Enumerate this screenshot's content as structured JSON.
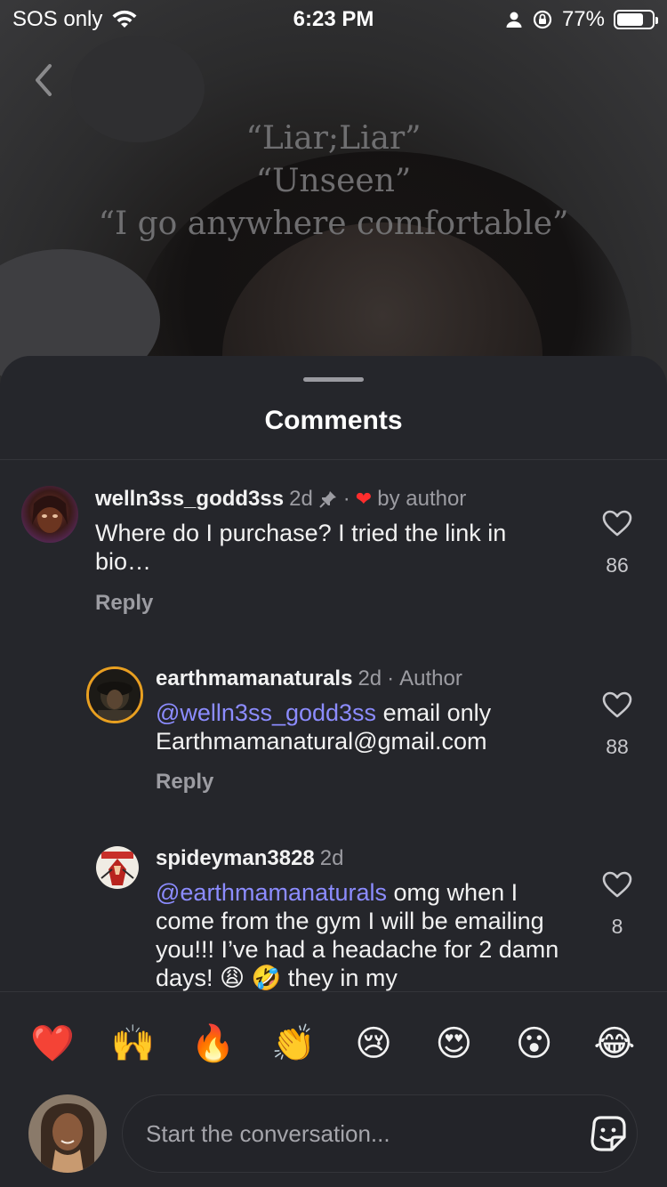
{
  "status_bar": {
    "carrier": "SOS only",
    "time": "6:23 PM",
    "battery": "77%",
    "battery_level": 0.77
  },
  "video_overlay": {
    "lines": [
      "“Liar;Liar”",
      "“Unseen”",
      "“I go anywhere comfortable”"
    ]
  },
  "sheet": {
    "title": "Comments"
  },
  "comments": [
    {
      "username": "welln3ss_godd3ss",
      "age": "2d",
      "meta_suffix": "by author",
      "text": "Where do I purchase? I tried the link in bio…",
      "reply_label": "Reply",
      "likes": "86",
      "pinned": true,
      "liked_by_author": true
    },
    {
      "username": "earthmamanaturals",
      "age": "2d",
      "meta_suffix": "Author",
      "mention": "@welln3ss_godd3ss",
      "text": " email only Earthmamanatural@gmail.com",
      "reply_label": "Reply",
      "likes": "88"
    },
    {
      "username": "spideyman3828",
      "age": "2d",
      "mention": "@earthmamanaturals",
      "text": " omg when I come from the gym I will be emailing you!!! I’ve had a headache for 2 damn days! 😩 🤣 they in my",
      "likes": "8"
    }
  ],
  "emoji_bar": [
    "❤️",
    "🙌",
    "🔥",
    "👏",
    "😢",
    "😍",
    "😮",
    "😂"
  ],
  "composer": {
    "placeholder": "Start the conversation..."
  }
}
